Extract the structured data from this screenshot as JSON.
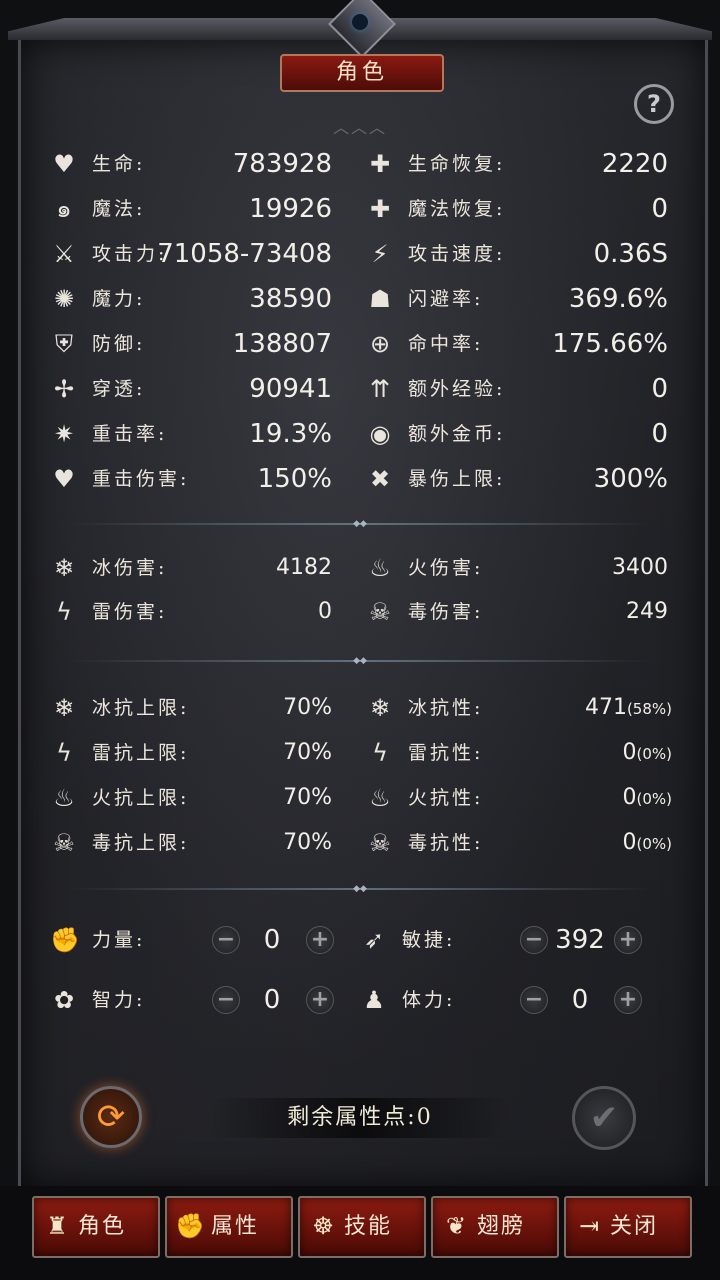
{
  "title": "角色",
  "help_icon": "?",
  "stats": [
    {
      "icon": "heart-icon",
      "glyph": "♥",
      "label": "生命:",
      "value": "783928"
    },
    {
      "icon": "heart-plus-icon",
      "glyph": "✚",
      "label": "生命恢复:",
      "value": "2220"
    },
    {
      "icon": "mana-swirl-icon",
      "glyph": "๑",
      "label": "魔法:",
      "value": "19926"
    },
    {
      "icon": "mana-plus-icon",
      "glyph": "✚",
      "label": "魔法恢复:",
      "value": "0"
    },
    {
      "icon": "sword-icon",
      "glyph": "⚔",
      "label": "攻击力:",
      "value": "71058-73408"
    },
    {
      "icon": "attack-speed-icon",
      "glyph": "⚡",
      "label": "攻击速度:",
      "value": "0.36S"
    },
    {
      "icon": "magic-power-icon",
      "glyph": "✺",
      "label": "魔力:",
      "value": "38590"
    },
    {
      "icon": "dodge-icon",
      "glyph": "☗",
      "label": "闪避率:",
      "value": "369.6%"
    },
    {
      "icon": "shield-icon",
      "glyph": "⛨",
      "label": "防御:",
      "value": "138807"
    },
    {
      "icon": "target-icon",
      "glyph": "⊕",
      "label": "命中率:",
      "value": "175.66%"
    },
    {
      "icon": "penetration-icon",
      "glyph": "✢",
      "label": "穿透:",
      "value": "90941"
    },
    {
      "icon": "exp-arrows-icon",
      "glyph": "⇈",
      "label": "额外经验:",
      "value": "0"
    },
    {
      "icon": "crit-rate-icon",
      "glyph": "✷",
      "label": "重击率:",
      "value": "19.3%"
    },
    {
      "icon": "coins-icon",
      "glyph": "◉",
      "label": "额外金币:",
      "value": "0"
    },
    {
      "icon": "crit-damage-icon",
      "glyph": "♥",
      "label": "重击伤害:",
      "value": "150%"
    },
    {
      "icon": "crit-cap-icon",
      "glyph": "✖",
      "label": "暴伤上限:",
      "value": "300%"
    }
  ],
  "damage": [
    {
      "icon": "ice-icon",
      "glyph": "❄",
      "label": "冰伤害:",
      "value": "4182"
    },
    {
      "icon": "fire-icon",
      "glyph": "♨",
      "label": "火伤害:",
      "value": "3400"
    },
    {
      "icon": "lightning-icon",
      "glyph": "ϟ",
      "label": "雷伤害:",
      "value": "0"
    },
    {
      "icon": "poison-icon",
      "glyph": "☠",
      "label": "毒伤害:",
      "value": "249"
    }
  ],
  "resists": [
    {
      "icon": "ice-cap-icon",
      "glyph": "❄",
      "label": "冰抗上限:",
      "value": "70%"
    },
    {
      "icon": "ice-resist-icon",
      "glyph": "❄",
      "label": "冰抗性:",
      "value": "471",
      "pct": "(58%)"
    },
    {
      "icon": "lightning-cap-icon",
      "glyph": "ϟ",
      "label": "雷抗上限:",
      "value": "70%"
    },
    {
      "icon": "lightning-resist-icon",
      "glyph": "ϟ",
      "label": "雷抗性:",
      "value": "0",
      "pct": "(0%)"
    },
    {
      "icon": "fire-cap-icon",
      "glyph": "♨",
      "label": "火抗上限:",
      "value": "70%"
    },
    {
      "icon": "fire-resist-icon",
      "glyph": "♨",
      "label": "火抗性:",
      "value": "0",
      "pct": "(0%)"
    },
    {
      "icon": "poison-cap-icon",
      "glyph": "☠",
      "label": "毒抗上限:",
      "value": "70%"
    },
    {
      "icon": "poison-resist-icon",
      "glyph": "☠",
      "label": "毒抗性:",
      "value": "0",
      "pct": "(0%)"
    }
  ],
  "attributes": [
    {
      "icon": "strength-fist-icon",
      "glyph": "✊",
      "label": "力量:",
      "value": "0"
    },
    {
      "icon": "agility-runner-icon",
      "glyph": "➶",
      "label": "敏捷:",
      "value": "392"
    },
    {
      "icon": "intelligence-brain-icon",
      "glyph": "✿",
      "label": "智力:",
      "value": "0"
    },
    {
      "icon": "stamina-body-icon",
      "glyph": "♟",
      "label": "体力:",
      "value": "0"
    }
  ],
  "minus_glyph": "−",
  "plus_glyph": "+",
  "remaining_points": "剩余属性点:0",
  "tabs": [
    {
      "icon": "character-armor-icon",
      "glyph": "♜",
      "label": "角色"
    },
    {
      "icon": "attribute-fist-icon",
      "glyph": "✊",
      "label": "属性"
    },
    {
      "icon": "skill-icon",
      "glyph": "☸",
      "label": "技能"
    },
    {
      "icon": "wings-icon",
      "glyph": "❦",
      "label": "翅膀"
    },
    {
      "icon": "exit-icon",
      "glyph": "⇥",
      "label": "关闭"
    }
  ]
}
